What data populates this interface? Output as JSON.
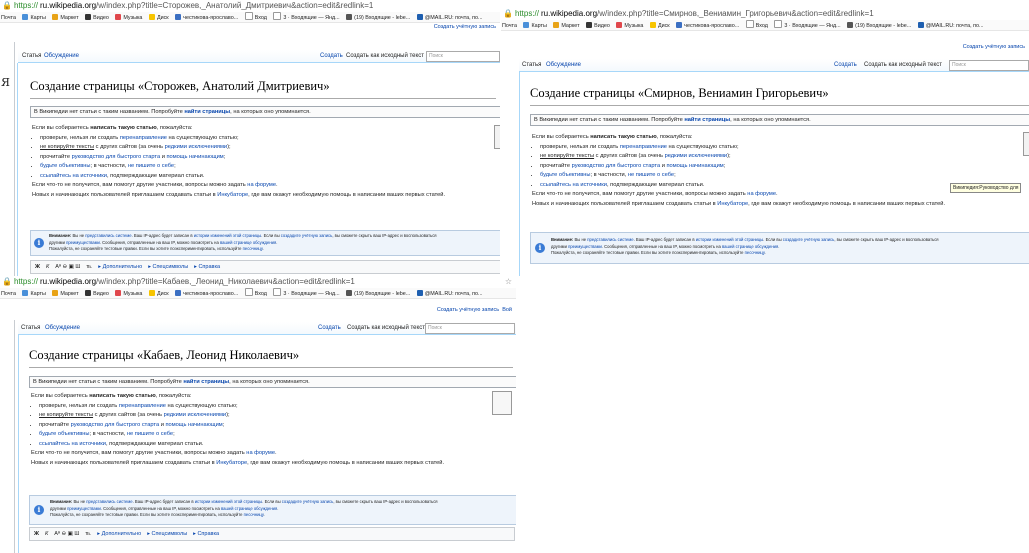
{
  "common": {
    "create_account": "Создать учётную запись",
    "tab_article": "Статья",
    "tab_discussion": "Обсуждение",
    "tab_create": "Создать",
    "tab_source": "Создать как исходный текст",
    "search_placeholder": "Поиск",
    "no_article_prefix": "В Википедии нет статьи с таким названием. Попробуйте ",
    "no_article_link": "найти страницы",
    "no_article_suffix": ", на которых оно упоминается.",
    "intro_prefix": "Если вы собираетесь ",
    "intro_bold": "написать такую статью",
    "intro_suffix": ", пожалуйста:",
    "b1_a": "проверьте, нельзя ли создать ",
    "b1_link": "перенаправление",
    "b1_b": " на существующую статью;",
    "b2_link": "не копируйте тексты",
    "b2_a": " с других сайтов (за очень ",
    "b2_link2": "редкими исключениями",
    "b2_b": ");",
    "b3_a": "прочитайте ",
    "b3_link": "руководство для быстрого старта",
    "b3_b": " и ",
    "b3_link2": "помощь начинающим",
    "b3_c": ";",
    "b4_link": "будьте объективны",
    "b4_a": "; в частности, ",
    "b4_link2": "не пишите о себе",
    "b4_b": ";",
    "b5_link": "ссылайтесь на источники",
    "b5_a": ", подтверждающие материал статьи.",
    "help_a": "Если что-то не получится, вам помогут другие участники, вопросы можно задать ",
    "help_link": "на форуме",
    "help_b": ".",
    "newbies_a": "Новых и начинающих пользователей приглашаем создавать статьи в ",
    "newbies_link": "Инкубаторе",
    "newbies_b": ", где вам окажут необходимую помощь в написании ваших первых статей.",
    "warn_line1_a": "Внимание: ",
    "warn_line1_b": "Вы не ",
    "warn_line1_link": "представились системе",
    "warn_line1_c": ". Ваш IP-адрес будет записан в ",
    "warn_line1_link2": "истории изменений этой страницы",
    "warn_line1_d": ". Если вы ",
    "warn_line1_link3": "создадите учётную запись",
    "warn_line1_e": ", вы сможете скрыть ваш IP-адрес и воспользоваться",
    "warn_line2_a": "другими ",
    "warn_line2_link": "преимуществами",
    "warn_line2_b": ". Сообщения, отправленные на ваш IP, можно посмотреть на ",
    "warn_line2_link2": "вашей странице обсуждения",
    "warn_line2_c": ".",
    "warn_line3_a": "Пожалуйста, не сохраняйте тестовые правки. Если вы хотите поэкспериментировать, используйте ",
    "warn_line3_link": "песочницу",
    "warn_line3_b": ".",
    "tb_bold": "Ж",
    "tb_italic": "К",
    "tb_extra": "Аª ⊖ ▣ Ш",
    "tb_sig": "℡",
    "tb_advanced": "Дополнительно",
    "tb_special": "Спецсимволы",
    "tb_help": "Справка"
  },
  "bookmarks": [
    {
      "label": "Почта",
      "color": "#f0f0f0"
    },
    {
      "label": "Карты",
      "color": "#4a90d9"
    },
    {
      "label": "Маркет",
      "color": "#e8a317"
    },
    {
      "label": "Видео",
      "color": "#333333"
    },
    {
      "label": "Музыка",
      "color": "#e0474c"
    },
    {
      "label": "Диск",
      "color": "#f7c400"
    },
    {
      "label": "честикова-ярославо...",
      "color": "#3b6fc2"
    },
    {
      "label": "Вход",
      "color": "#cccccc"
    },
    {
      "label": "3 · Входящие — Янд...",
      "color": "#cccccc"
    },
    {
      "label": "(19) Входящие - lebe...",
      "color": "#555555"
    },
    {
      "label": "@MAIL.RU: почта, по...",
      "color": "#1e5fb0"
    }
  ],
  "windows": [
    {
      "url_scheme": "https://",
      "url_host": "ru.wikipedia.org",
      "url_path": "/w/index.php?title=Сторожев,_Анатолий_Дмитриевич&action=edit&redlink=1",
      "title": "Создание страницы «Сторожев, Анатолий Дмитриевич»",
      "rail_glyph": "Я",
      "rail_links": [
        "з",
        "о",
        "е",
        "у",
        "е",
        "с"
      ]
    },
    {
      "url_scheme": "https://",
      "url_host": "ru.wikipedia.org",
      "url_path": "/w/index.php?title=Смирнов,_Вениамин_Григорьевич&action=edit&redlink=1",
      "title": "Создание страницы «Смирнов, Вениамин Григорьевич»",
      "tooltip": "Википедия:Руководство для"
    },
    {
      "url_scheme": "https://",
      "url_host": "ru.wikipedia.org",
      "url_path": "/w/index.php?title=Кабаев,_Леонид_Николаевич&action=edit&redlink=1",
      "title": "Создание страницы «Кабаев, Леонид Николаевич»",
      "create_account_extra": "Вой"
    }
  ]
}
